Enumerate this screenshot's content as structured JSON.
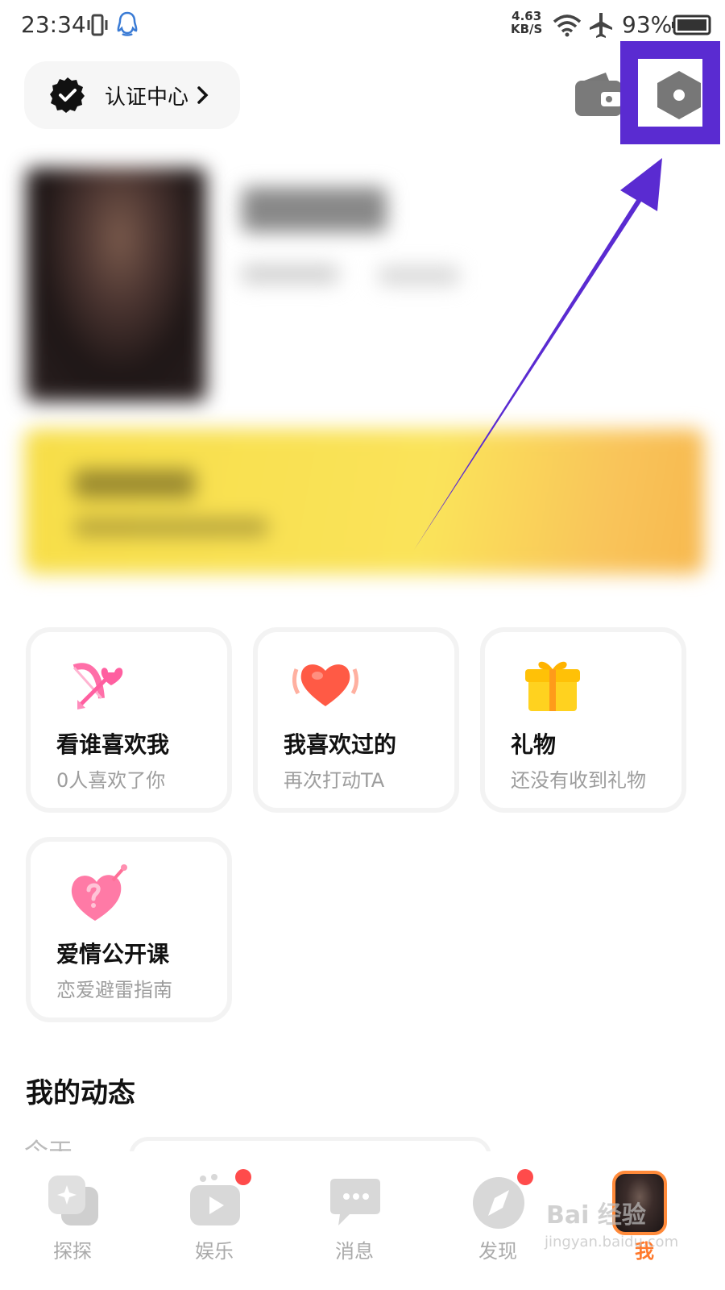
{
  "status_bar": {
    "time": "23:34",
    "speed_value": "4.63",
    "speed_unit": "KB/S",
    "battery": "93%"
  },
  "header": {
    "cert_label": "认证中心",
    "highlight_color": "#5a2bd1"
  },
  "cards": [
    {
      "title": "看谁喜欢我",
      "subtitle": "0人喜欢了你",
      "icon": "cupid-bow-icon"
    },
    {
      "title": "我喜欢过的",
      "subtitle": "再次打动TA",
      "icon": "heart-icon"
    },
    {
      "title": "礼物",
      "subtitle": "还没有收到礼物",
      "icon": "gift-icon"
    },
    {
      "title": "爱情公开课",
      "subtitle": "恋爱避雷指南",
      "icon": "question-heart-icon"
    }
  ],
  "section": {
    "title": "我的动态",
    "today_label": "今天"
  },
  "nav": [
    {
      "label": "探探",
      "badge": false
    },
    {
      "label": "娱乐",
      "badge": true
    },
    {
      "label": "消息",
      "badge": false
    },
    {
      "label": "发现",
      "badge": true
    },
    {
      "label": "我",
      "badge": false,
      "active": true
    }
  ],
  "watermark": {
    "brand": "Bai 经验",
    "url": "jingyan.baidu.com"
  },
  "colors": {
    "accent": "#ff7a2d",
    "badge": "#ff4b4b",
    "banner": "#fae35a"
  }
}
